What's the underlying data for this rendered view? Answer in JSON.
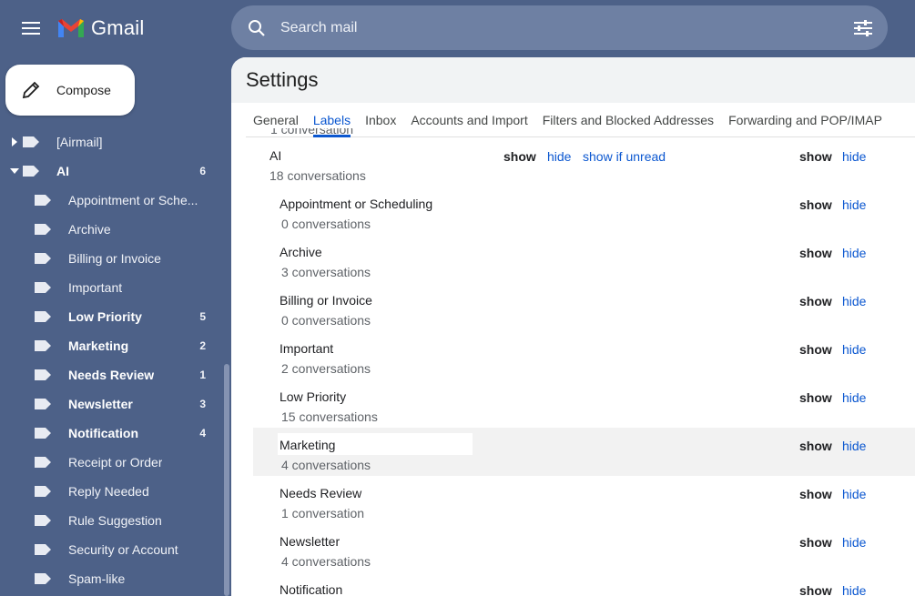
{
  "app": {
    "name": "Gmail"
  },
  "search": {
    "placeholder": "Search mail"
  },
  "compose": {
    "label": "Compose"
  },
  "sidebar": {
    "items": [
      {
        "label": "[Airmail]",
        "count": "",
        "bold": false,
        "level": 0,
        "arrow": "right"
      },
      {
        "label": "AI",
        "count": "6",
        "bold": true,
        "level": 0,
        "arrow": "down"
      },
      {
        "label": "Appointment or Sche...",
        "count": "",
        "bold": false,
        "level": 1
      },
      {
        "label": "Archive",
        "count": "",
        "bold": false,
        "level": 1
      },
      {
        "label": "Billing or Invoice",
        "count": "",
        "bold": false,
        "level": 1
      },
      {
        "label": "Important",
        "count": "",
        "bold": false,
        "level": 1
      },
      {
        "label": "Low Priority",
        "count": "5",
        "bold": true,
        "level": 1
      },
      {
        "label": "Marketing",
        "count": "2",
        "bold": true,
        "level": 1
      },
      {
        "label": "Needs Review",
        "count": "1",
        "bold": true,
        "level": 1
      },
      {
        "label": "Newsletter",
        "count": "3",
        "bold": true,
        "level": 1
      },
      {
        "label": "Notification",
        "count": "4",
        "bold": true,
        "level": 1
      },
      {
        "label": "Receipt or Order",
        "count": "",
        "bold": false,
        "level": 1
      },
      {
        "label": "Reply Needed",
        "count": "",
        "bold": false,
        "level": 1
      },
      {
        "label": "Rule Suggestion",
        "count": "",
        "bold": false,
        "level": 1
      },
      {
        "label": "Security or Account",
        "count": "",
        "bold": false,
        "level": 1
      },
      {
        "label": "Spam-like",
        "count": "",
        "bold": false,
        "level": 1
      }
    ]
  },
  "settings": {
    "title": "Settings",
    "tabs": [
      "General",
      "Labels",
      "Inbox",
      "Accounts and Import",
      "Filters and Blocked Addresses",
      "Forwarding and POP/IMAP"
    ],
    "active_tab": "Labels",
    "partial_top_text": "1 conversation",
    "parent_row": {
      "name": "AI",
      "count": "18 conversations",
      "list_show": "show",
      "list_hide": "hide",
      "list_unread": "show if unread",
      "msg_show": "show",
      "msg_hide": "hide"
    },
    "labels": [
      {
        "name": "Appointment or Scheduling",
        "count": "0 conversations"
      },
      {
        "name": "Archive",
        "count": "3 conversations"
      },
      {
        "name": "Billing or Invoice",
        "count": "0 conversations"
      },
      {
        "name": "Important",
        "count": "2 conversations"
      },
      {
        "name": "Low Priority",
        "count": "15 conversations"
      },
      {
        "name": "Marketing",
        "count": "4 conversations",
        "selected": true
      },
      {
        "name": "Needs Review",
        "count": "1 conversation"
      },
      {
        "name": "Newsletter",
        "count": "4 conversations"
      },
      {
        "name": "Notification",
        "count": ""
      }
    ],
    "show_label": "show",
    "hide_label": "hide"
  },
  "colors": {
    "background": "#4d6188",
    "link": "#0b57d0",
    "accent_tab": "#0b57d0"
  },
  "icons": [
    "menu-icon",
    "gmail-logo-icon",
    "search-icon",
    "filter-options-icon",
    "pencil-icon",
    "label-tag-icon",
    "expand-arrow-icon"
  ]
}
